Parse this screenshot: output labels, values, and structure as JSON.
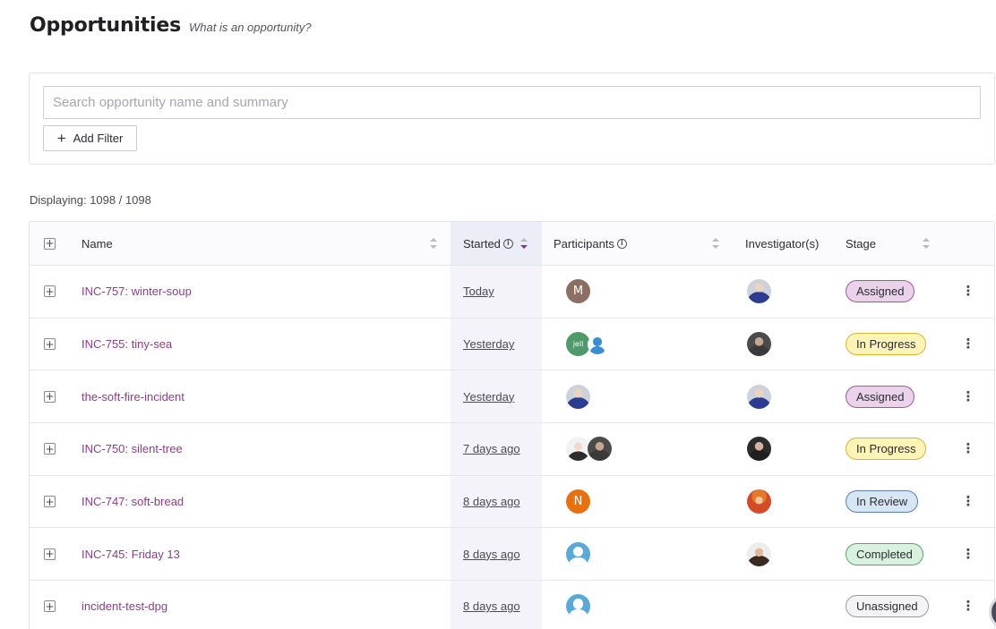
{
  "header": {
    "title": "Opportunities",
    "help_link": "What is an opportunity?"
  },
  "search": {
    "placeholder": "Search opportunity name and summary",
    "value": ""
  },
  "filters": {
    "add_filter_label": "Add Filter"
  },
  "display_count": "Displaying: 1098 / 1098",
  "columns": {
    "name": "Name",
    "started": "Started",
    "participants": "Participants",
    "investigators": "Investigator(s)",
    "stage": "Stage"
  },
  "rows": [
    {
      "name": "INC-757: winter-soup",
      "started": "Today",
      "participants": [
        {
          "type": "initial",
          "text": "M",
          "style": "av-m"
        }
      ],
      "investigator": "av-photo1",
      "stage": "Assigned",
      "stage_style": "b-assigned"
    },
    {
      "name": "INC-755: tiny-sea",
      "started": "Yesterday",
      "participants": [
        {
          "type": "initial",
          "text": "jell",
          "style": "av-green"
        },
        {
          "type": "user",
          "style": "av-user-sm"
        }
      ],
      "investigator": "av-photo2",
      "stage": "In Progress",
      "stage_style": "b-progress"
    },
    {
      "name": "the-soft-fire-incident",
      "started": "Yesterday",
      "participants": [
        {
          "type": "photo",
          "style": "av-photo1"
        }
      ],
      "investigator": "av-photo1",
      "stage": "Assigned",
      "stage_style": "b-assigned"
    },
    {
      "name": "INC-750: silent-tree",
      "started": "7 days ago",
      "participants": [
        {
          "type": "photo",
          "style": "av-photo3"
        },
        {
          "type": "photo",
          "style": "av-photo2"
        }
      ],
      "investigator": "av-photo4",
      "stage": "In Progress",
      "stage_style": "b-progress"
    },
    {
      "name": "INC-747: soft-bread",
      "started": "8 days ago",
      "participants": [
        {
          "type": "initial",
          "text": "N",
          "style": "av-n"
        }
      ],
      "investigator": "av-photo5",
      "stage": "In Review",
      "stage_style": "b-review"
    },
    {
      "name": "INC-745: Friday 13",
      "started": "8 days ago",
      "participants": [
        {
          "type": "user",
          "style": "av-user"
        }
      ],
      "investigator": "av-photo6",
      "stage": "Completed",
      "stage_style": "b-completed"
    },
    {
      "name": "incident-test-dpg",
      "started": "8 days ago",
      "participants": [
        {
          "type": "user",
          "style": "av-user"
        }
      ],
      "investigator": "",
      "stage": "Unassigned",
      "stage_style": "b-unassigned"
    }
  ],
  "icons": {
    "expand": "plus-square-icon",
    "sort": "sort-arrows-icon",
    "info": "info-circle-icon",
    "more": "kebab-menu-icon",
    "add": "plus-icon"
  },
  "colors": {
    "link": "#8a3f86",
    "sort_active": "#7b3a86",
    "started_column_bg": "#f3f3f9"
  }
}
